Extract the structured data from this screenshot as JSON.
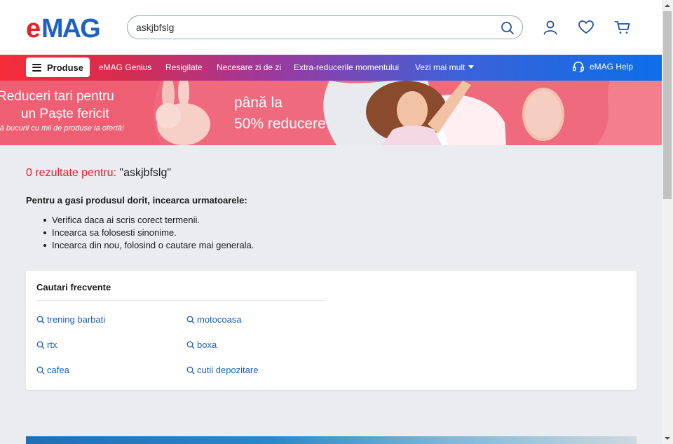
{
  "header": {
    "logo_text": "eMAG",
    "search": {
      "value": "askjbfslg",
      "placeholder": ""
    },
    "icons": [
      "search-icon",
      "account-icon",
      "heart-icon",
      "cart-icon"
    ]
  },
  "nav": {
    "produse_label": "Produse",
    "links": [
      "eMAG Genius",
      "Resigilate",
      "Necesare zi de zi",
      "Extra-reducerile momentului",
      "Vezi mai mult"
    ],
    "help_label": "eMAG Help"
  },
  "banner": {
    "line1": "Reduceri tari pentru",
    "line2": "un Paște fericit",
    "line3": "ră bucurii cu mii de produse la ofertă!",
    "pana": "până la",
    "reducere": "50% reducere"
  },
  "results": {
    "count_text": "0 rezultate pentru:",
    "query_text": "\"askjbfslg\"",
    "tips_heading": "Pentru a gasi produsul dorit, incearca urmatoarele:",
    "tips": [
      "Verifica daca ai scris corect termenii.",
      "Incearca sa folosesti sinonime.",
      "Incearca din nou, folosind o cautare mai generala."
    ]
  },
  "frequent": {
    "title": "Cautari frecvente",
    "items": [
      "trening barbati",
      "motocoasa",
      "rtx",
      "boxa",
      "cafea",
      "cutii depozitare"
    ]
  },
  "colors": {
    "brand_red": "#e4202a",
    "link_blue": "#1a5fb4",
    "nav_start": "#f52d3a",
    "nav_end": "#0d6ee8",
    "banner_pink": "#f06a7e",
    "page_bg": "#eaecf0"
  }
}
